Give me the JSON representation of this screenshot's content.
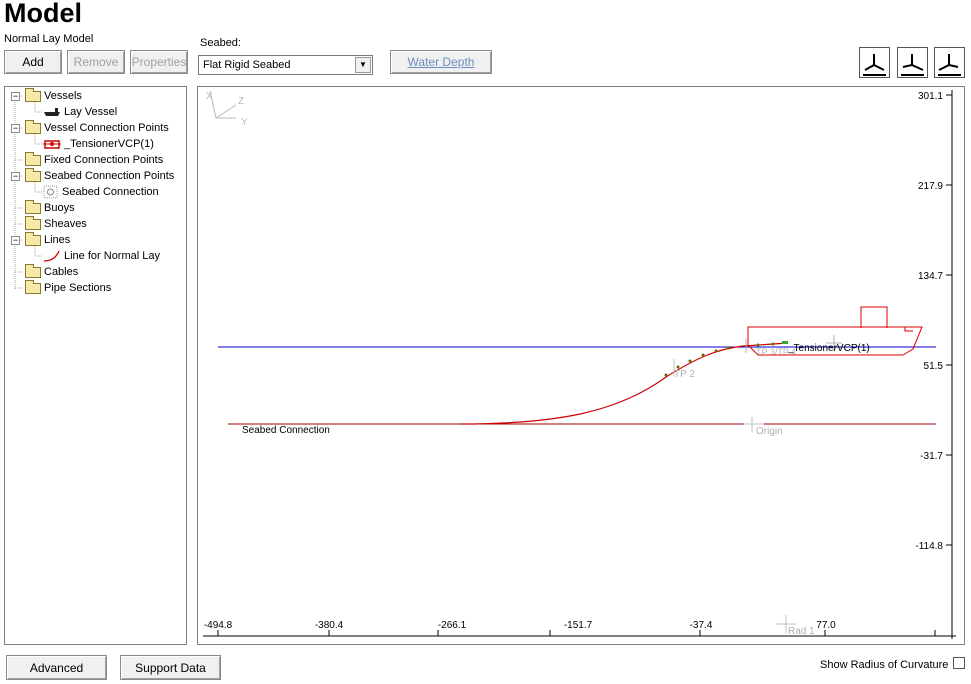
{
  "header": {
    "title": "Model",
    "subtitle": "Normal Lay Model"
  },
  "toolbar": {
    "add": "Add",
    "remove": "Remove",
    "properties": "Properties",
    "water_depth": "Water Depth"
  },
  "seabed": {
    "label": "Seabed:",
    "selected": "Flat Rigid Seabed"
  },
  "view_buttons": [
    "view-3d-icon",
    "view-side-icon",
    "view-plan-icon"
  ],
  "tree": {
    "vessels": "Vessels",
    "lay_vessel": "Lay Vessel",
    "vessel_connection_points": "Vessel Connection Points",
    "tensioner_vcp": "_TensionerVCP(1)",
    "fixed_connection_points": "Fixed Connection Points",
    "seabed_connection_points": "Seabed Connection Points",
    "seabed_connection": "Seabed Connection",
    "buoys": "Buoys",
    "sheaves": "Sheaves",
    "lines": "Lines",
    "line_normal_lay": "Line for Normal Lay",
    "cables": "Cables",
    "pipe_sections": "Pipe Sections"
  },
  "plot": {
    "axis_triad": {
      "x": "X",
      "z": "Z",
      "y": "Y"
    },
    "y_ticks": [
      "301.1",
      "217.9",
      "134.7",
      "51.5",
      "-31.7",
      "-114.8"
    ],
    "x_ticks": [
      "-494.8",
      "-380.4",
      "-266.1",
      "-151.7",
      "-37.4",
      "77.0"
    ],
    "labels": {
      "seabed_connection": "Seabed Connection",
      "tensioner": "_TensionerVCP(1)",
      "tp2": "TP 2",
      "origin": "Origin",
      "rad1": "Rad 1",
      "tp_faint": "TP 3/TP 4"
    },
    "colors": {
      "water_line": "#0000cc",
      "seabed_line": "#aa0000",
      "pipe": "#cc0000",
      "vessel": "#dd0000",
      "faint": "#b0b0b0"
    }
  },
  "footer": {
    "advanced": "Advanced",
    "support_data": "Support Data",
    "radius_label": "Show Radius of Curvature",
    "radius_checked": false
  }
}
